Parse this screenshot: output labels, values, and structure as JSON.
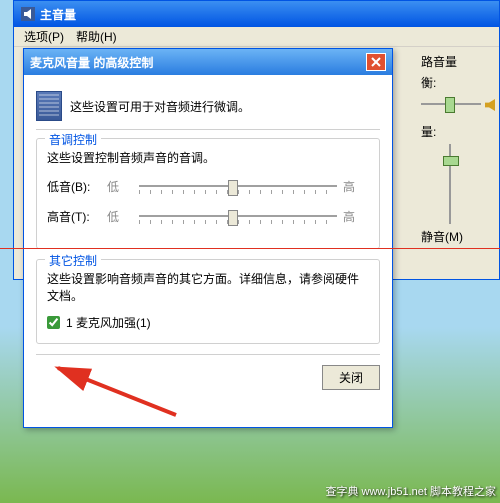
{
  "main_window": {
    "title": "主音量",
    "menu": {
      "options": "选项(P)",
      "help": "帮助(H)"
    },
    "right": {
      "balance_label": "衡:",
      "volume_group_label": "量:",
      "section_label": "路音量",
      "mute_label": "静音(M)"
    }
  },
  "dialog": {
    "title": "麦克风音量 的高级控制",
    "intro": "这些设置可用于对音频进行微调。",
    "tone": {
      "legend": "音调控制",
      "desc": "这些设置控制音频声音的音调。",
      "bass_label": "低音(B):",
      "treble_label": "高音(T):",
      "low_text": "低",
      "high_text": "高"
    },
    "other": {
      "legend": "其它控制",
      "desc": "这些设置影响音频声音的其它方面。详细信息，请参阅硬件文档。",
      "mic_boost_label": "1 麦克风加强(1)",
      "mic_boost_checked": true
    },
    "close_btn": "关闭"
  },
  "watermark": "查字典 www.jb51.net 脚本教程之家"
}
